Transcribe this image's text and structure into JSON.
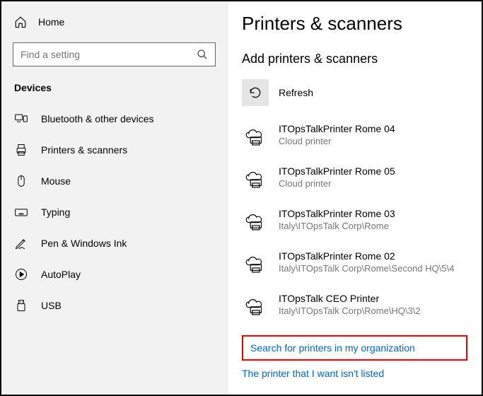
{
  "sidebar": {
    "home_label": "Home",
    "search_placeholder": "Find a setting",
    "category": "Devices",
    "items": [
      {
        "label": "Bluetooth & other devices"
      },
      {
        "label": "Printers & scanners"
      },
      {
        "label": "Mouse"
      },
      {
        "label": "Typing"
      },
      {
        "label": "Pen & Windows Ink"
      },
      {
        "label": "AutoPlay"
      },
      {
        "label": "USB"
      }
    ]
  },
  "main": {
    "page_title": "Printers & scanners",
    "section_title": "Add printers & scanners",
    "refresh_label": "Refresh",
    "printers": [
      {
        "name": "ITOpsTalkPrinter Rome 04",
        "sub": "Cloud printer"
      },
      {
        "name": "ITOpsTalkPrinter Rome 05",
        "sub": "Cloud printer"
      },
      {
        "name": "ITOpsTalkPrinter Rome 03",
        "sub": "Italy\\ITOpsTalk Corp\\Rome"
      },
      {
        "name": "ITOpsTalkPrinter Rome 02",
        "sub": "Italy\\ITOpsTalk Corp\\Rome\\Second HQ\\5\\4"
      },
      {
        "name": "ITOpsTalk CEO Printer",
        "sub": "Italy\\ITOpsTalk Corp\\Rome\\HQ\\3\\2"
      }
    ],
    "link_search_org": "Search for printers in my organization",
    "link_not_listed": "The printer that I want isn't listed"
  }
}
